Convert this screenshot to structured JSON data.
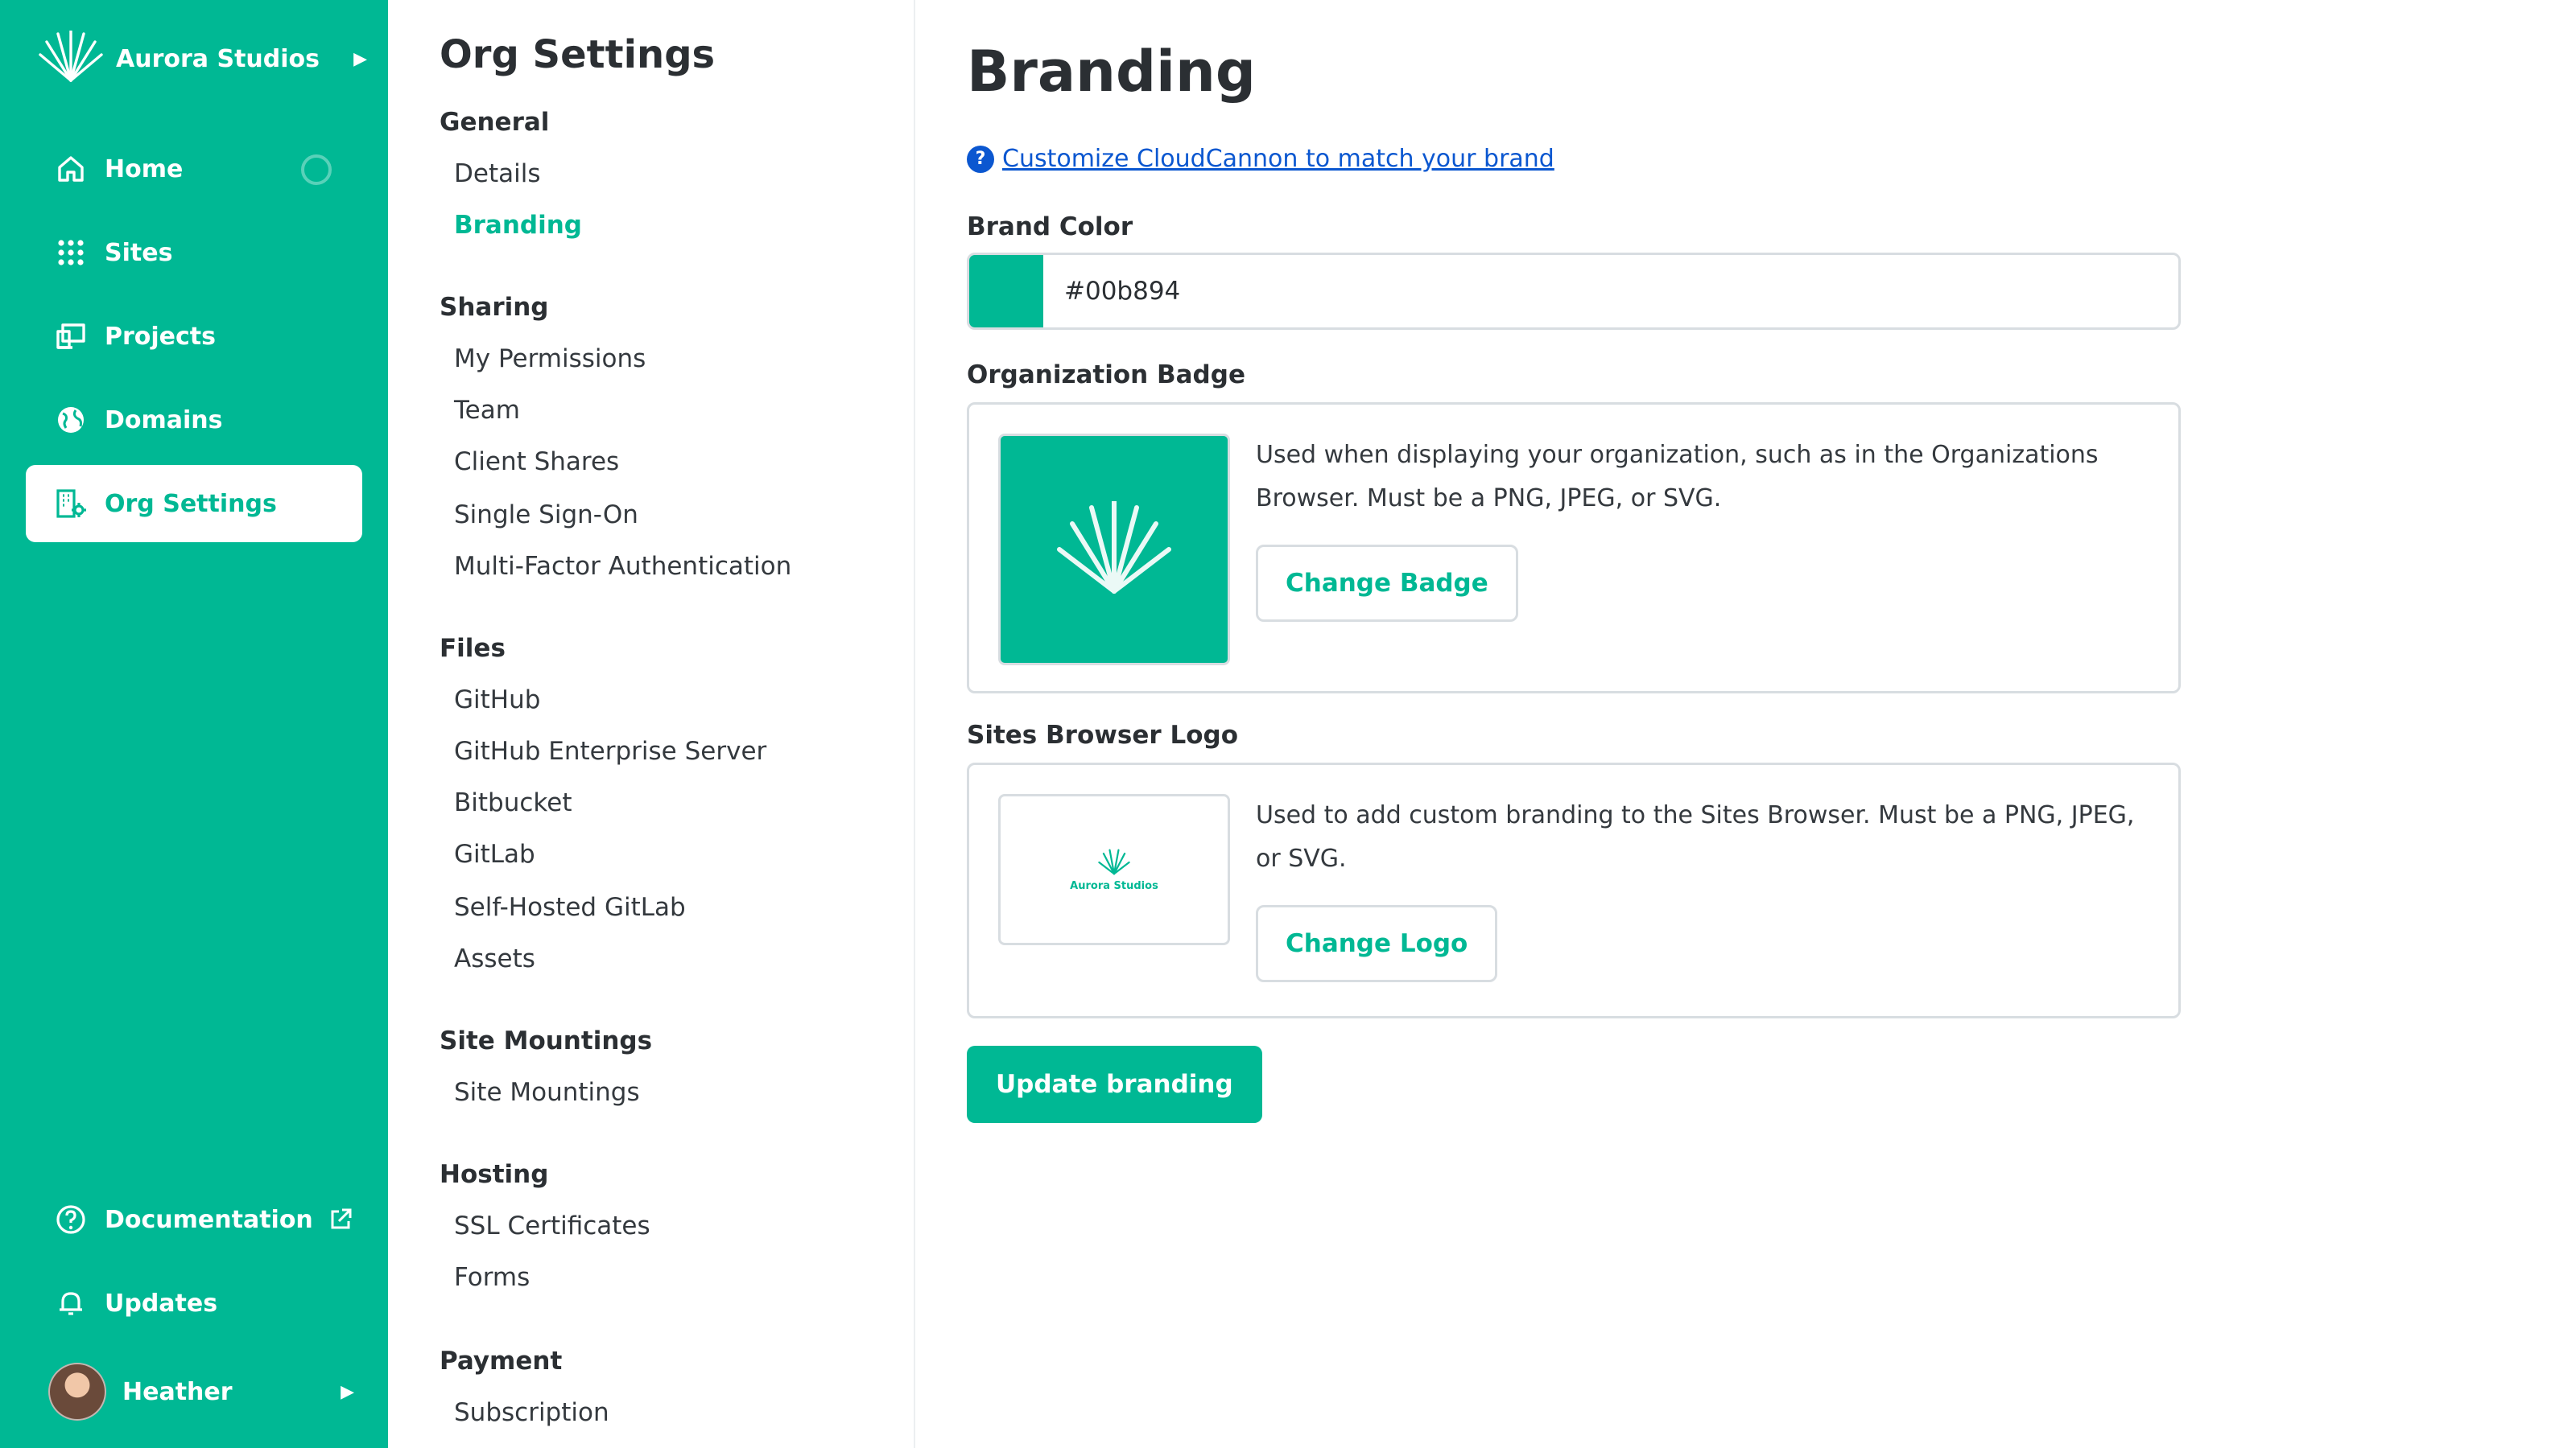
{
  "sidebar": {
    "org_name": "Aurora Studios",
    "nav": [
      {
        "label": "Home",
        "icon": "home-icon"
      },
      {
        "label": "Sites",
        "icon": "grid-icon"
      },
      {
        "label": "Projects",
        "icon": "devices-icon"
      },
      {
        "label": "Domains",
        "icon": "globe-icon"
      },
      {
        "label": "Org Settings",
        "icon": "org-settings-icon",
        "active": true
      }
    ],
    "bottom": [
      {
        "label": "Documentation",
        "icon": "help-circle-icon",
        "external": true
      },
      {
        "label": "Updates",
        "icon": "bell-icon"
      }
    ],
    "user_name": "Heather",
    "accent_color": "#00b894"
  },
  "submenu": {
    "title": "Org Settings",
    "groups": [
      {
        "label": "General",
        "items": [
          "Details",
          "Branding"
        ]
      },
      {
        "label": "Sharing",
        "items": [
          "My Permissions",
          "Team",
          "Client Shares",
          "Single Sign-On",
          "Multi-Factor Authentication"
        ]
      },
      {
        "label": "Files",
        "items": [
          "GitHub",
          "GitHub Enterprise Server",
          "Bitbucket",
          "GitLab",
          "Self-Hosted GitLab",
          "Assets"
        ]
      },
      {
        "label": "Site Mountings",
        "items": [
          "Site Mountings"
        ]
      },
      {
        "label": "Hosting",
        "items": [
          "SSL Certificates",
          "Forms"
        ]
      },
      {
        "label": "Payment",
        "items": [
          "Subscription"
        ]
      }
    ],
    "active_item": "Branding"
  },
  "main": {
    "title": "Branding",
    "help_link": "Customize CloudCannon to match your brand",
    "brand_color": {
      "label": "Brand Color",
      "value": "#00b894"
    },
    "org_badge": {
      "label": "Organization Badge",
      "description": "Used when displaying your organization, such as in the Organizations Browser. Must be a PNG, JPEG, or SVG.",
      "button": "Change Badge"
    },
    "sites_logo": {
      "label": "Sites Browser Logo",
      "description": "Used to add custom branding to the Sites Browser. Must be a PNG, JPEG, or SVG.",
      "button": "Change Logo",
      "preview_text": "Aurora Studios"
    },
    "submit": "Update branding"
  }
}
